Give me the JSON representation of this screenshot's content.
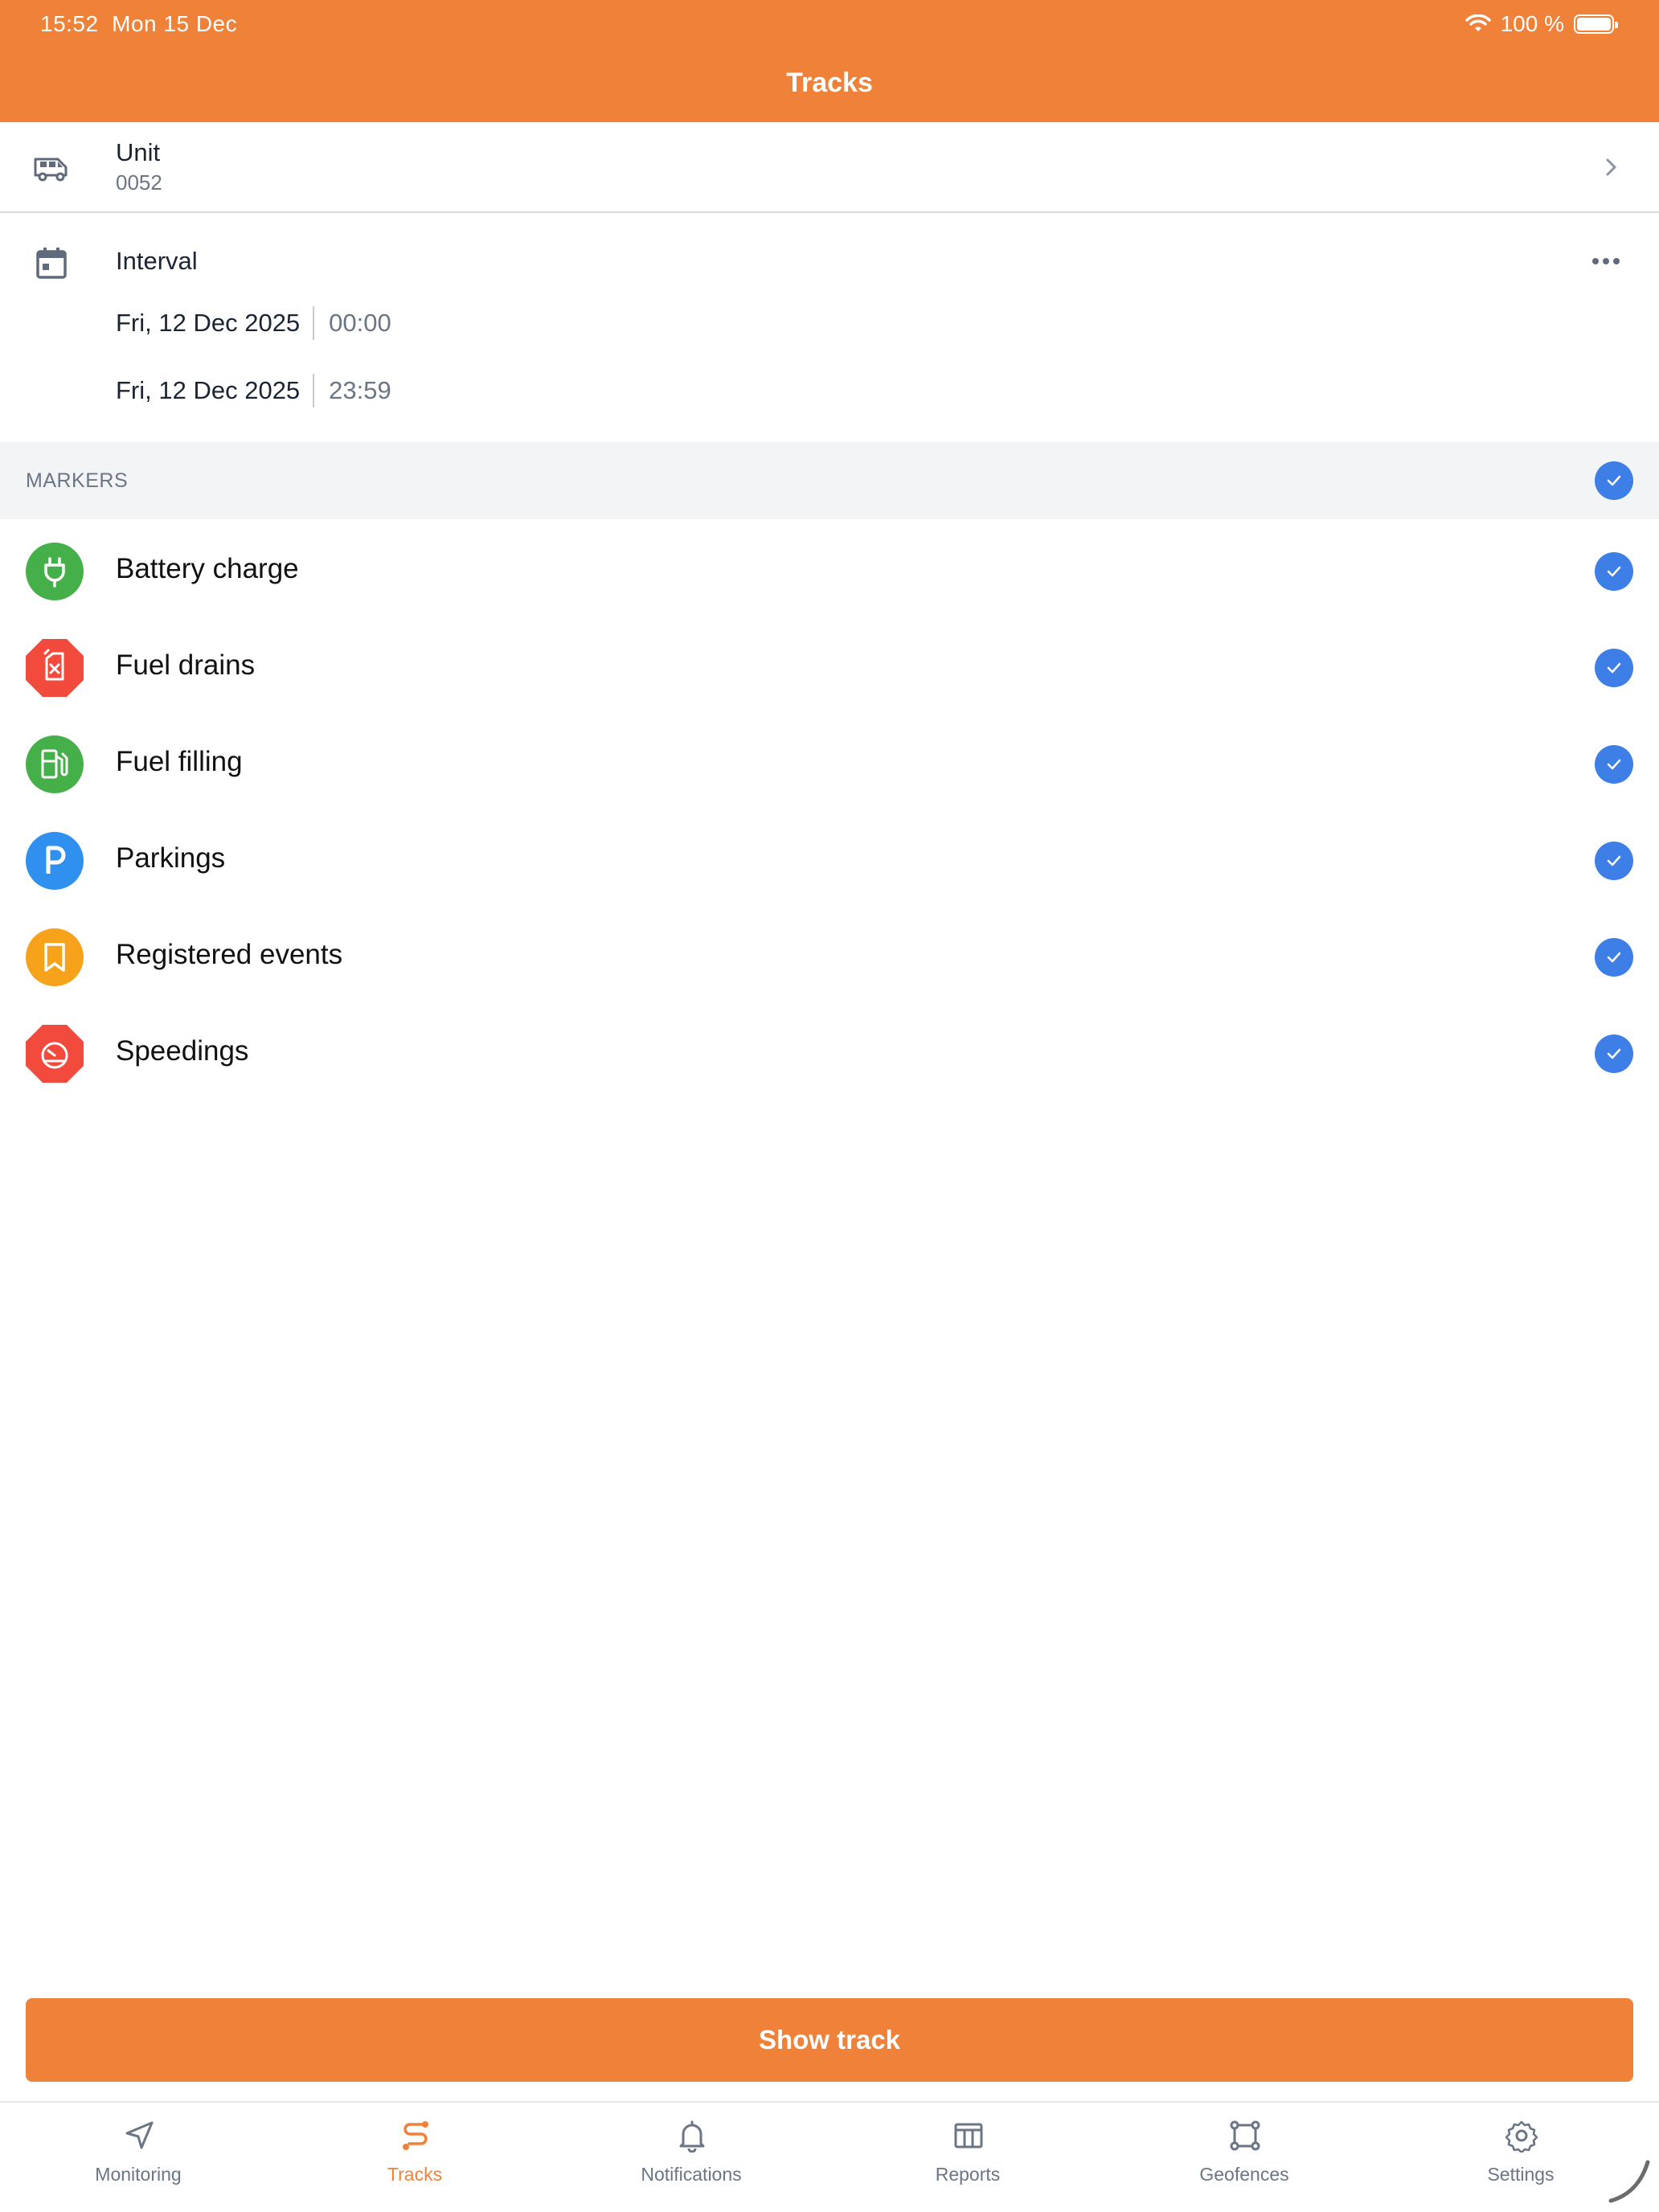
{
  "status_bar": {
    "time": "15:52",
    "date": "Mon 15 Dec",
    "battery": "100 %"
  },
  "header": {
    "title": "Tracks"
  },
  "unit": {
    "label": "Unit",
    "value": "0052"
  },
  "interval": {
    "label": "Interval",
    "start": {
      "date": "Fri, 12 Dec 2025",
      "time": "00:00"
    },
    "end": {
      "date": "Fri, 12 Dec 2025",
      "time": "23:59"
    }
  },
  "markers": {
    "title": "MARKERS",
    "items": [
      {
        "label": "Battery charge",
        "icon": "plug-icon",
        "color": "#45b04a"
      },
      {
        "label": "Fuel drains",
        "icon": "fuel-can-icon",
        "color": "#f24a3d"
      },
      {
        "label": "Fuel filling",
        "icon": "fuel-pump-icon",
        "color": "#45b04a"
      },
      {
        "label": "Parkings",
        "icon": "parking-icon",
        "color": "#2f90ef"
      },
      {
        "label": "Registered events",
        "icon": "bookmark-icon",
        "color": "#f7a21b"
      },
      {
        "label": "Speedings",
        "icon": "speedometer-icon",
        "color": "#f24a3d"
      }
    ]
  },
  "show_track": {
    "label": "Show track"
  },
  "tabs": [
    {
      "label": "Monitoring",
      "icon": "navigation-arrow-icon"
    },
    {
      "label": "Tracks",
      "icon": "route-icon",
      "active": true
    },
    {
      "label": "Notifications",
      "icon": "bell-icon"
    },
    {
      "label": "Reports",
      "icon": "table-icon"
    },
    {
      "label": "Geofences",
      "icon": "polygon-icon"
    },
    {
      "label": "Settings",
      "icon": "gear-icon"
    }
  ],
  "colors": {
    "accent": "#f08139",
    "check": "#3d7fe6"
  }
}
